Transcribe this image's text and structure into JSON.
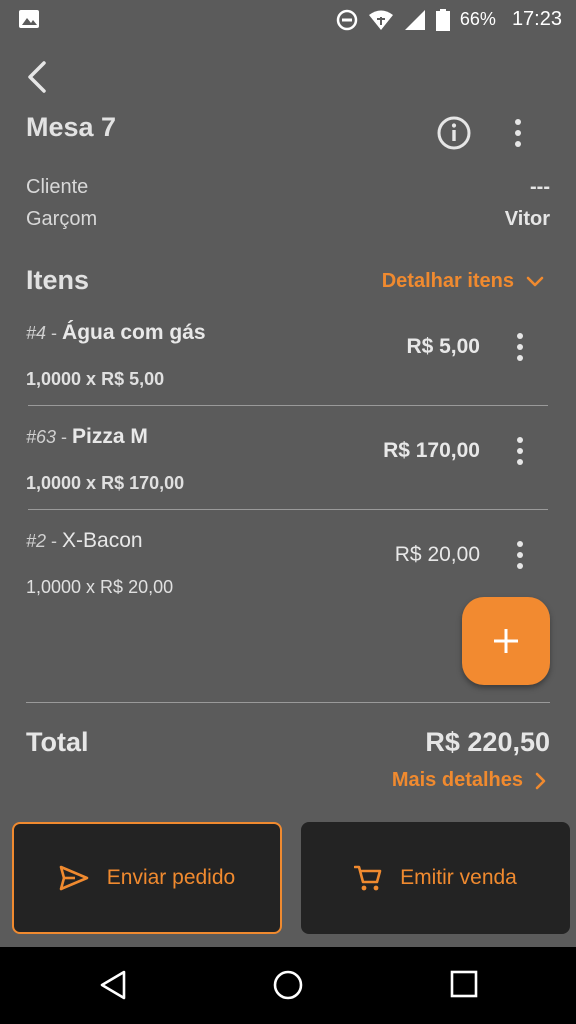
{
  "status_bar": {
    "battery": "66%",
    "time": "17:23"
  },
  "header": {
    "title": "Mesa 7"
  },
  "info": {
    "client_label": "Cliente",
    "client_value": "---",
    "waiter_label": "Garçom",
    "waiter_value": "Vitor"
  },
  "items_section": {
    "title": "Itens",
    "detail_link": "Detalhar itens",
    "items": [
      {
        "number": "#4",
        "separator": " - ",
        "name": "Água com gás",
        "quantity": "1,0000 x R$ 5,00",
        "price": "R$ 5,00"
      },
      {
        "number": "#63",
        "separator": " - ",
        "name": "Pizza M",
        "quantity": "1,0000 x R$ 170,00",
        "price": "R$ 170,00"
      },
      {
        "number": "#2",
        "separator": " - ",
        "name": "X-Bacon",
        "quantity": "1,0000 x R$ 20,00",
        "price": "R$ 20,00"
      }
    ]
  },
  "totals": {
    "label": "Total",
    "value": "R$ 220,50",
    "more_details": "Mais detalhes"
  },
  "actions": {
    "send_label": "Enviar pedido",
    "sell_label": "Emitir venda"
  },
  "colors": {
    "accent": "#f08a2f",
    "background": "#5b5b5b",
    "button_bg": "#232323"
  },
  "icons": [
    "image-icon",
    "dnd-icon",
    "wifi-icon",
    "signal-icon",
    "battery-icon",
    "back-arrow-icon",
    "info-icon",
    "more-vert-icon",
    "chevron-down-icon",
    "chevron-right-icon",
    "plus-icon",
    "send-icon",
    "cart-icon",
    "nav-back-icon",
    "nav-home-icon",
    "nav-recents-icon"
  ]
}
